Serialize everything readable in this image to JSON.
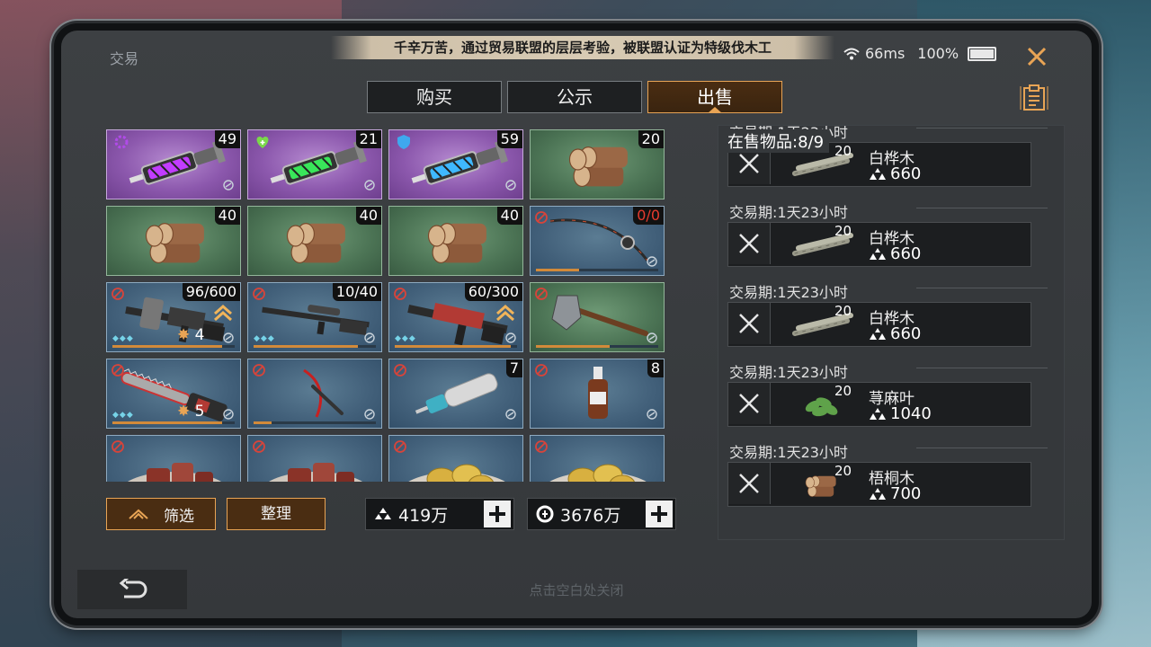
{
  "window": {
    "title": "交易"
  },
  "banner": {
    "text": "千辛万苦，通过贸易联盟的层层考验，被联盟认证为特级伐木工"
  },
  "status": {
    "latency": "66ms",
    "battery": "100%"
  },
  "tabs": [
    {
      "label": "购买",
      "active": false
    },
    {
      "label": "公示",
      "active": false
    },
    {
      "label": "出售",
      "active": true
    }
  ],
  "inventory": [
    {
      "kind": "syringe",
      "rarity": "purple",
      "count": "49",
      "gem": "cog",
      "accent": "#c23cff"
    },
    {
      "kind": "syringe",
      "rarity": "purple",
      "count": "21",
      "gem": "heart",
      "accent": "#39e65a"
    },
    {
      "kind": "syringe",
      "rarity": "purple",
      "count": "59",
      "gem": "shield",
      "accent": "#3fb8ff"
    },
    {
      "kind": "log",
      "rarity": "green",
      "count": "20"
    },
    {
      "kind": "log",
      "rarity": "green",
      "count": "40"
    },
    {
      "kind": "log",
      "rarity": "green",
      "count": "40"
    },
    {
      "kind": "log",
      "rarity": "green",
      "count": "40"
    },
    {
      "kind": "rod",
      "rarity": "blue",
      "count": "0/0",
      "locked": true,
      "count_color": "red",
      "bar": 0.35
    },
    {
      "kind": "rifle-heavy",
      "rarity": "blue",
      "count": "96/600",
      "locked": true,
      "level": "4",
      "bar": 0.9,
      "upgrade": true
    },
    {
      "kind": "rifle-sniper",
      "rarity": "blue",
      "count": "10/40",
      "locked": true,
      "bar": 0.85
    },
    {
      "kind": "rifle-red",
      "rarity": "blue",
      "count": "60/300",
      "locked": true,
      "bar": 0.95,
      "upgrade": true
    },
    {
      "kind": "axe",
      "rarity": "green",
      "locked": true,
      "bar": 0.6
    },
    {
      "kind": "chainsaw",
      "rarity": "blue",
      "locked": true,
      "level": "5",
      "bar": 0.9
    },
    {
      "kind": "pickaxe",
      "rarity": "blue",
      "locked": true,
      "bar": 0.15
    },
    {
      "kind": "injector",
      "rarity": "blue",
      "count": "7",
      "locked": true
    },
    {
      "kind": "bottle",
      "rarity": "blue",
      "count": "8",
      "locked": true
    },
    {
      "kind": "meat-plate",
      "rarity": "blue",
      "locked": true
    },
    {
      "kind": "meat-plate",
      "rarity": "blue",
      "locked": true
    },
    {
      "kind": "coin-plate",
      "rarity": "blue",
      "locked": true
    },
    {
      "kind": "coin-plate",
      "rarity": "blue",
      "locked": true
    }
  ],
  "buttons": {
    "filter": "筛选",
    "sort": "整理"
  },
  "wallet": [
    {
      "icon": "silver-ingot-icon",
      "value": "419万"
    },
    {
      "icon": "gold-coin-icon",
      "value": "3676万"
    }
  ],
  "selling": {
    "header": "在售物品:8/9",
    "listings": [
      {
        "period": "交易期:1天23小时",
        "name": "白桦木",
        "qty": "20",
        "price": "660",
        "thumb": "birch"
      },
      {
        "period": "交易期:1天23小时",
        "name": "白桦木",
        "qty": "20",
        "price": "660",
        "thumb": "birch"
      },
      {
        "period": "交易期:1天23小时",
        "name": "白桦木",
        "qty": "20",
        "price": "660",
        "thumb": "birch"
      },
      {
        "period": "交易期:1天23小时",
        "name": "荨麻叶",
        "qty": "20",
        "price": "1040",
        "thumb": "nettle"
      },
      {
        "period": "交易期:1天23小时",
        "name": "梧桐木",
        "qty": "20",
        "price": "700",
        "thumb": "log"
      }
    ]
  },
  "footer": {
    "hint": "点击空白处关闭"
  },
  "colors": {
    "accent": "#e8a455",
    "purple": "#8c58ad",
    "green": "#4c7455",
    "blue": "#42607a"
  }
}
